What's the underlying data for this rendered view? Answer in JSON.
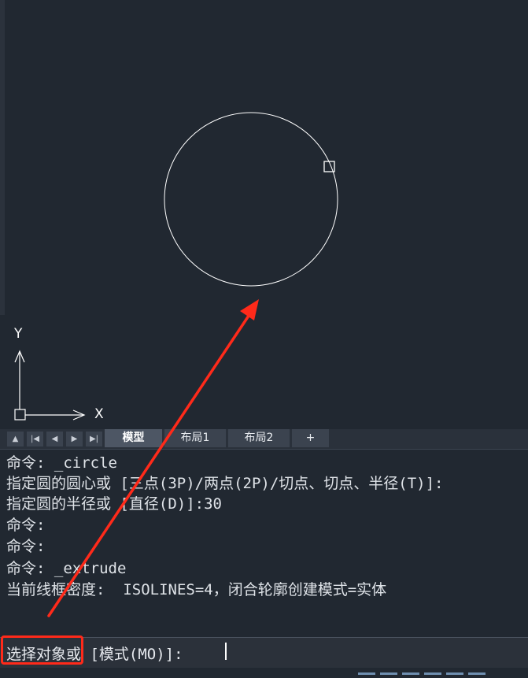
{
  "canvas": {
    "ucs": {
      "y_label": "Y",
      "x_label": "X"
    }
  },
  "layout_tabs": {
    "nav_buttons": [
      "▲",
      "|◀",
      "◀",
      "▶",
      "▶|"
    ],
    "tabs": [
      {
        "label": "模型",
        "active": true
      },
      {
        "label": "布局1",
        "active": false
      },
      {
        "label": "布局2",
        "active": false
      },
      {
        "label": "+",
        "active": false
      }
    ]
  },
  "command_history": {
    "lines": [
      "命令: _circle",
      "指定圆的圆心或 [三点(3P)/两点(2P)/切点、切点、半径(T)]:",
      "指定圆的半径或 [直径(D)]:30",
      "命令:",
      "命令:",
      "命令: _extrude",
      "当前线框密度:  ISOLINES=4，闭合轮廓创建模式=实体"
    ]
  },
  "command_prompt": {
    "text": "选择对象或 [模式(MO)]:"
  },
  "colors": {
    "background": "#212831",
    "annotation": "#ff2a1a",
    "text": "#dfe3e8"
  }
}
